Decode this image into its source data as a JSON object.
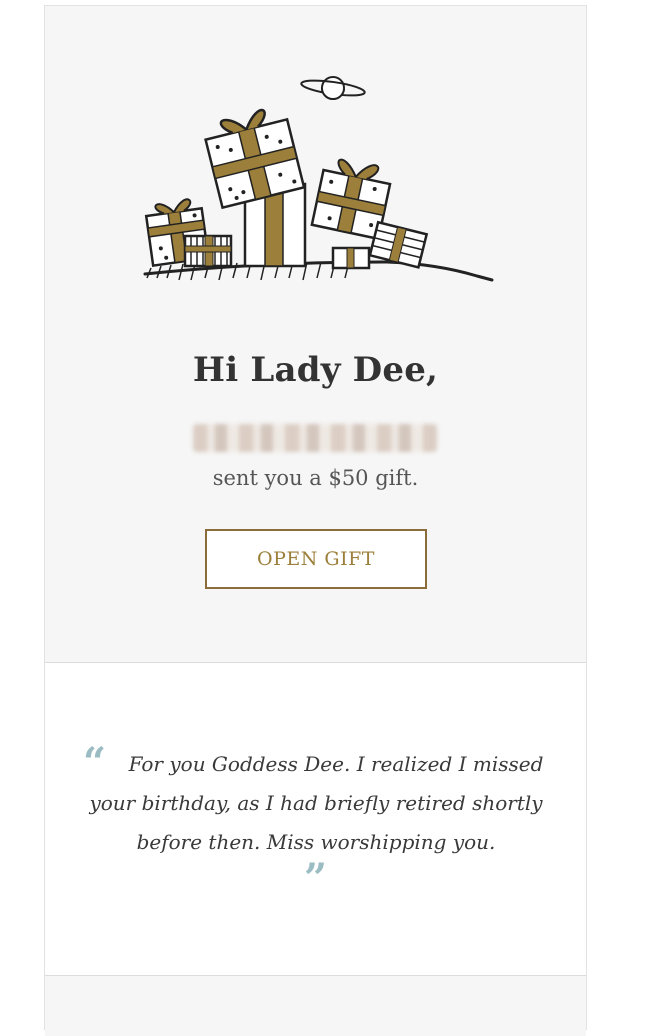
{
  "hero": {
    "greeting": "Hi Lady Dee,",
    "sender_name": "",
    "sent_text": "sent you a $50 gift.",
    "open_button_label": "OPEN GIFT"
  },
  "message": {
    "open_quote": "“",
    "text": "For you Goddess Dee. I realized I missed your birthday, as I had briefly retired shortly before then. Miss worshipping you.",
    "close_quote": "”"
  },
  "colors": {
    "background": "#f6f6f6",
    "gold_accent": "#9c7f3a",
    "quote_mark": "#9cbcc4",
    "heading": "#333333"
  },
  "icons": {
    "illustration": "gift-boxes-planet-illustration"
  }
}
